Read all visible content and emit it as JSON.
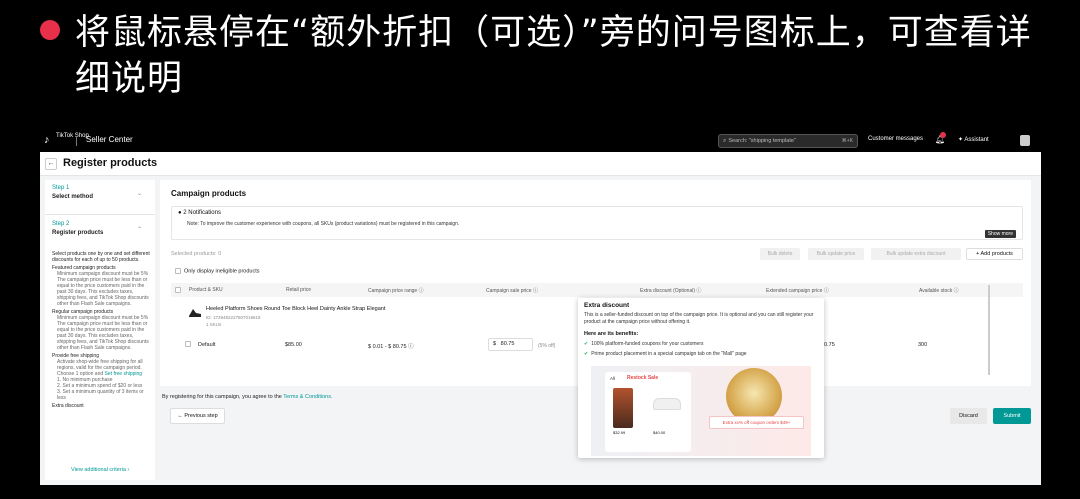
{
  "slide": {
    "title": "将鼠标悬停在“额外折扣（可选）”旁的问号图标上，可查看详细说明"
  },
  "topbar": {
    "logo_text": "TikTok Shop",
    "app_name": "Seller Center",
    "search_placeholder": "Search: \"shipping template\"",
    "search_shortcut": "⌘+K",
    "customer_messages": "Customer messages",
    "assistant": "Assistant"
  },
  "page": {
    "title": "Register products"
  },
  "steps": {
    "step1": {
      "label": "Step 1",
      "name": "Select method"
    },
    "step2": {
      "label": "Step 2",
      "name": "Register products"
    },
    "intro": "Select products one by one and set different discounts for each of up to 50 products.",
    "featured": {
      "heading": "Featured campaign products",
      "items": [
        "Minimum campaign discount must be 5%",
        "The campaign price must be less than or equal to the price customers paid in the past 30 days. This excludes taxes, shipping fees, and TikTok Shop discounts other than Flash Sale campaigns."
      ]
    },
    "regular": {
      "heading": "Regular campaign products",
      "items": [
        "Minimum campaign discount must be 5%",
        "The campaign price must be less than or equal to the price customers paid in the past 30 days. This excludes taxes, shipping fees, and TikTok Shop discounts other than Flash Sale campaigns."
      ]
    },
    "shipping": {
      "heading": "Provide free shipping",
      "text": "Activate shop-wide free shipping for all regions, valid for the campaign period. Choose 1 option and",
      "link": "Set free shipping",
      "items": [
        "1. No minimum purchase",
        "2. Set a minimum spend of $20 or less",
        "3. Set a minimum quantity of 3 items or less"
      ]
    },
    "extra": {
      "heading": "Extra discount"
    },
    "view_criteria": "View additional criteria"
  },
  "main": {
    "title": "Campaign products",
    "notifications": {
      "title": "2 Notifications",
      "text": "Note: To improve the customer experience with coupons, all SKUs (product variations) must be registered in this campaign.",
      "show_more": "Show more"
    },
    "selected": "Selected products: 0",
    "bulk_buttons": [
      "Bulk delete",
      "Bulk update price",
      "Bulk update extra discount"
    ],
    "add_products": "+ Add products",
    "only_ineligible": "Only display ineligible products",
    "columns": [
      "Product & SKU",
      "Retail price",
      "Campaign price range",
      "Campaign sale price",
      "Extra discount (Optional)",
      "Extended campaign price",
      "Available stock"
    ],
    "product": {
      "name": "Heeled Platform Shoes Round Toe Block Heel Dainty Ankle Strap Elegant",
      "id": "ID: 1729482227607019618",
      "skus": "1 SKUs"
    },
    "row": {
      "sku": "Default",
      "retail": "$85.00",
      "range": "$ 0.01 - $ 80.75",
      "currency": "$",
      "sale_price": "80.75",
      "pct_off": "(5% off)",
      "extended": "80.75",
      "stock": "300"
    }
  },
  "footer": {
    "terms_prefix": "By registering for this campaign, you agree to the",
    "terms_link": "Terms & Conditions.",
    "previous": "Previous step",
    "discard": "Discard",
    "submit": "Submit"
  },
  "tooltip": {
    "title": "Extra discount",
    "body": "This is a seller-funded discount on top of the campaign price. It is optional and you can still register your product at the campaign price without offering it.",
    "benefits_heading": "Here are its benefits:",
    "benefits": [
      "100% platform-funded coupons for your customers",
      "Prime product placement in a special campaign tab on the \"Mall\" page"
    ],
    "mock": {
      "tab_all": "All",
      "restock": "Restock Sale",
      "price1": "$32.99",
      "price2": "$40.00",
      "coupon": "Extra xx% off coupon orders $49+"
    }
  }
}
